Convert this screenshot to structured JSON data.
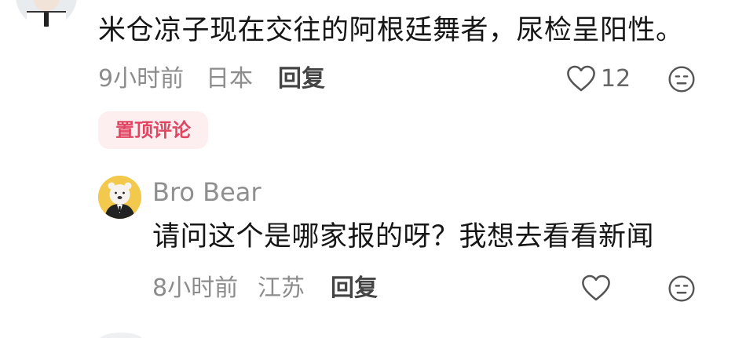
{
  "comments": [
    {
      "text": "米仓凉子现在交往的阿根廷舞者，尿检呈阳性。",
      "time": "9小时前",
      "location": "日本",
      "reply_label": "回复",
      "like_count": "12",
      "badge": "置顶评论",
      "icons": [
        "heart-icon",
        "emoji-icon"
      ]
    },
    {
      "author": "Bro Bear",
      "text": "请问这个是哪家报的呀？我想去看看新闻",
      "time": "8小时前",
      "location": "江苏",
      "reply_label": "回复",
      "icons": [
        "heart-icon",
        "emoji-icon"
      ]
    }
  ],
  "colors": {
    "badge_bg": "#fdeef0",
    "badge_text": "#e04561",
    "meta_text": "#8c8c8c",
    "body_text": "#161616"
  }
}
